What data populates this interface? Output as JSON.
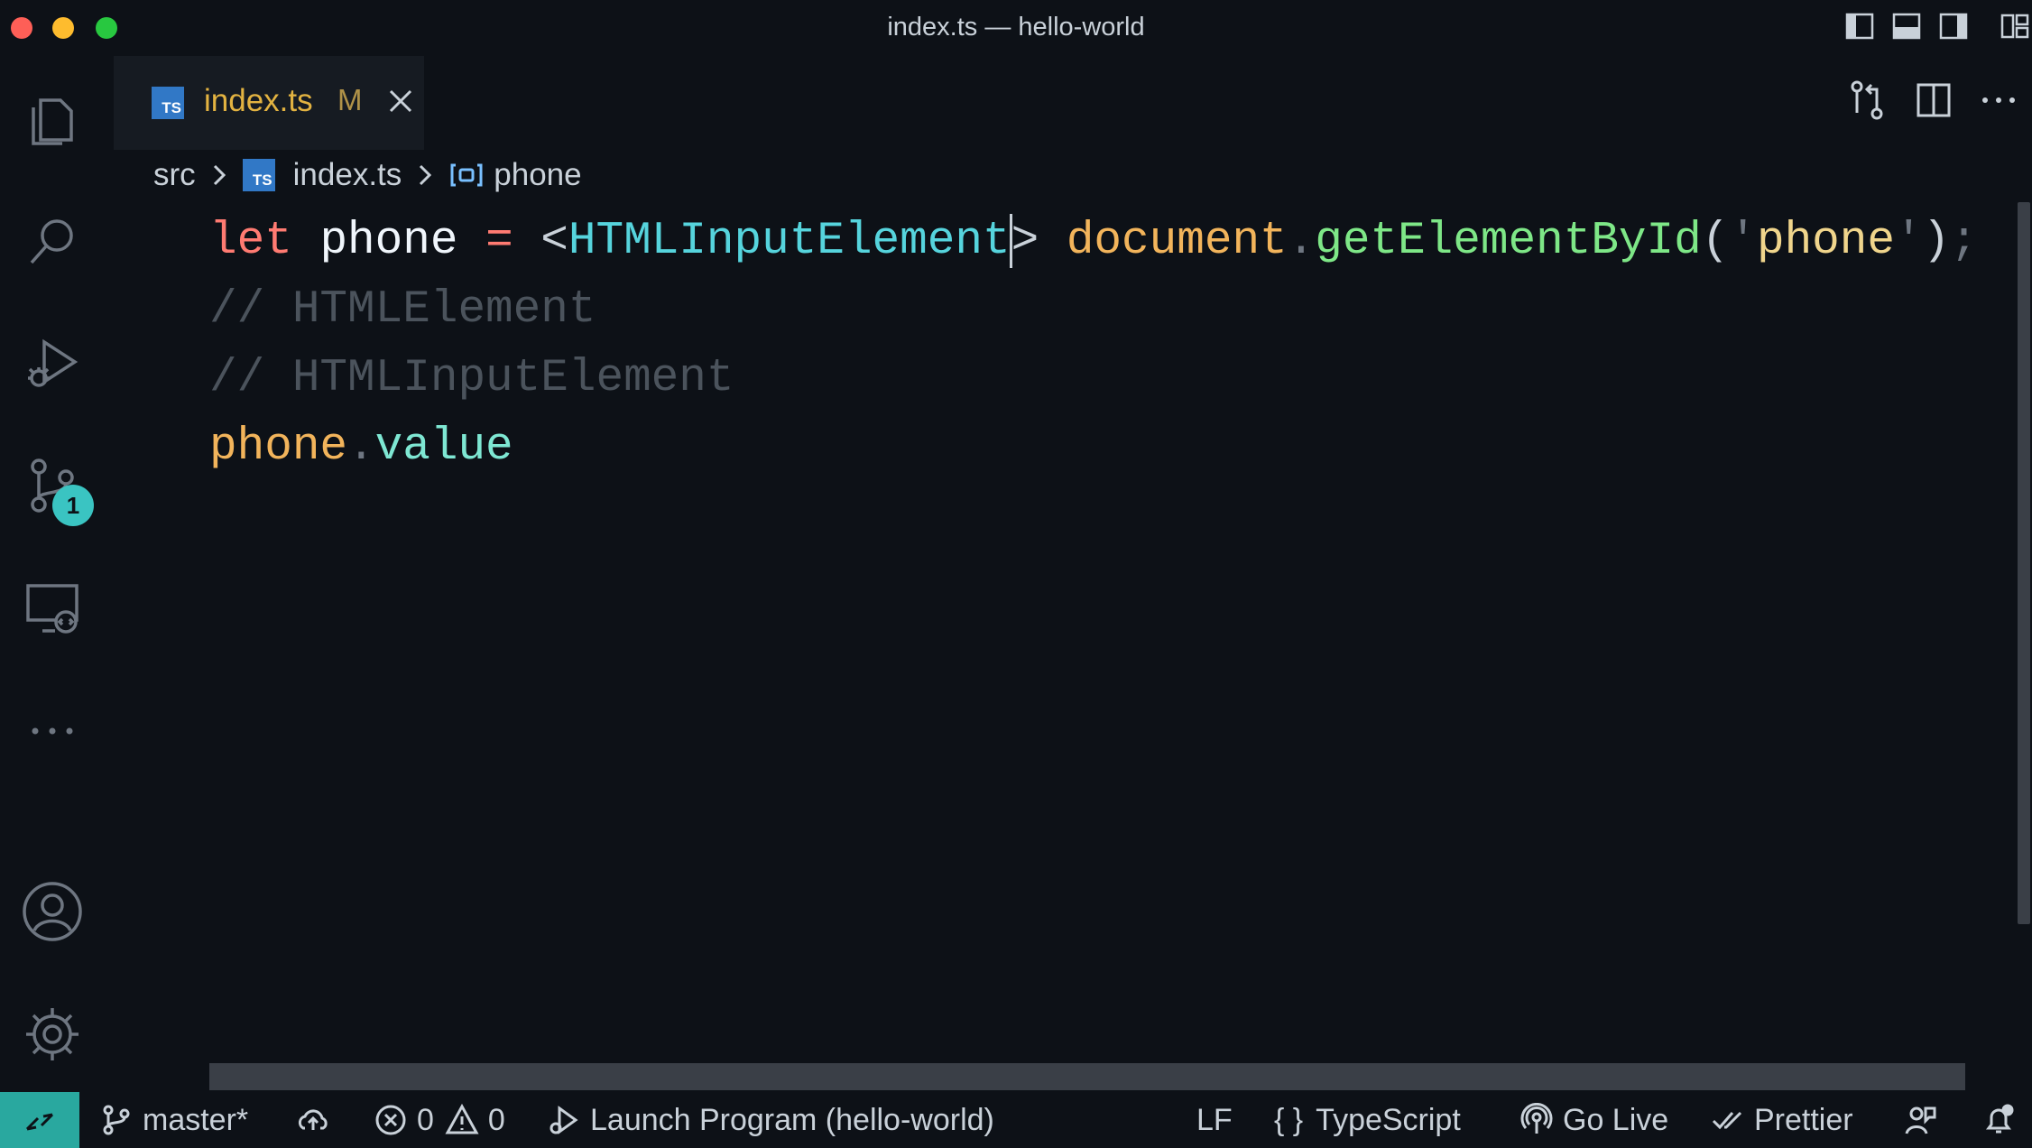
{
  "window": {
    "title": "index.ts — hello-world"
  },
  "activity_bar": {
    "items": [
      {
        "name": "explorer"
      },
      {
        "name": "search"
      },
      {
        "name": "run-and-debug"
      },
      {
        "name": "source-control",
        "badge": "1"
      },
      {
        "name": "remote-explorer"
      },
      {
        "name": "more"
      },
      {
        "name": "accounts"
      },
      {
        "name": "manage"
      }
    ]
  },
  "tab": {
    "icon_text": "TS",
    "label": "index.ts",
    "modified": "M"
  },
  "breadcrumb": {
    "folder": "src",
    "file": "index.ts",
    "symbol": "phone"
  },
  "code_lines": [
    [
      {
        "t": "let",
        "c": "kw"
      },
      {
        "t": " ",
        "c": "punc"
      },
      {
        "t": "phone",
        "c": "var"
      },
      {
        "t": " ",
        "c": "punc"
      },
      {
        "t": "=",
        "c": "op"
      },
      {
        "t": " ",
        "c": "punc"
      },
      {
        "t": "<",
        "c": "punc"
      },
      {
        "t": "HTMLInputElement",
        "c": "type"
      },
      {
        "t": "|",
        "c": "cursor"
      },
      {
        "t": ">",
        "c": "punc"
      },
      {
        "t": " ",
        "c": "punc"
      },
      {
        "t": "document",
        "c": "obj"
      },
      {
        "t": ".",
        "c": "dim"
      },
      {
        "t": "getElementById",
        "c": "fn"
      },
      {
        "t": "(",
        "c": "punc"
      },
      {
        "t": "'",
        "c": "dim"
      },
      {
        "t": "phone",
        "c": "str"
      },
      {
        "t": "'",
        "c": "dim"
      },
      {
        "t": ")",
        "c": "punc"
      },
      {
        "t": ";",
        "c": "dim"
      }
    ],
    [
      {
        "t": "// HTMLElement",
        "c": "cmt"
      }
    ],
    [
      {
        "t": "// HTMLInputElement",
        "c": "cmt"
      }
    ],
    [
      {
        "t": "phone",
        "c": "obj"
      },
      {
        "t": ".",
        "c": "dim"
      },
      {
        "t": "value",
        "c": "prop"
      }
    ]
  ],
  "status_bar": {
    "branch": "master*",
    "errors": "0",
    "warnings": "0",
    "launch": "Launch Program (hello-world)",
    "eol": "LF",
    "language_icon": "{ }",
    "language": "TypeScript",
    "go_live": "Go Live",
    "prettier": "Prettier"
  },
  "colors": {
    "background": "#0d1117",
    "accent": "#3ac4c2",
    "remote": "#29a89f",
    "tab_label": "#e3b341",
    "ts_icon": "#3178c6"
  }
}
